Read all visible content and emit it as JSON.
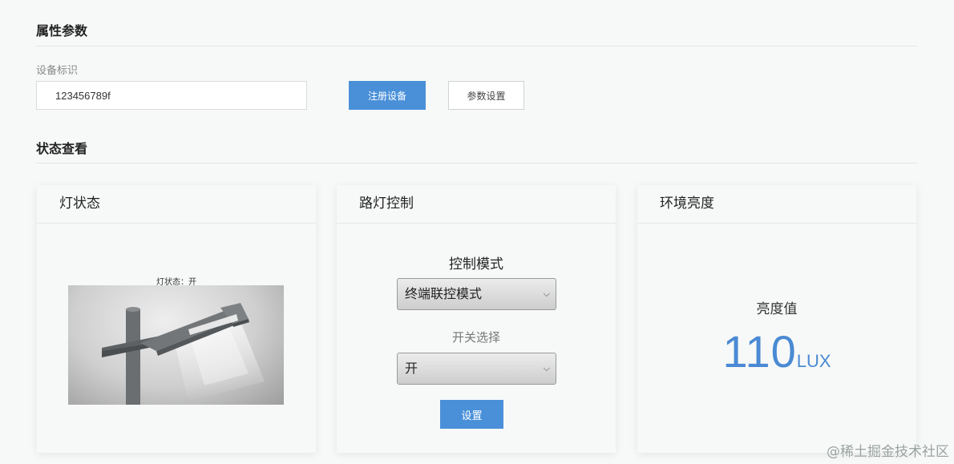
{
  "attributes": {
    "section_title": "属性参数",
    "device_id_label": "设备标识",
    "device_id_value": "123456789f",
    "register_button": "注册设备",
    "settings_button": "参数设置"
  },
  "status": {
    "section_title": "状态查看"
  },
  "lamp_card": {
    "title": "灯状态",
    "caption": "灯状态：开"
  },
  "control_card": {
    "title": "路灯控制",
    "mode_label": "控制模式",
    "mode_selected": "终端联控模式",
    "switch_label": "开关选择",
    "switch_selected": "开",
    "set_button": "设置"
  },
  "brightness_card": {
    "title": "环境亮度",
    "label": "亮度值",
    "value": "110",
    "unit": "LUX"
  },
  "watermark": "@稀土掘金技术社区",
  "colors": {
    "accent": "#4a90d9",
    "value_blue": "#4a8ad4",
    "background": "#f7f9f8"
  }
}
